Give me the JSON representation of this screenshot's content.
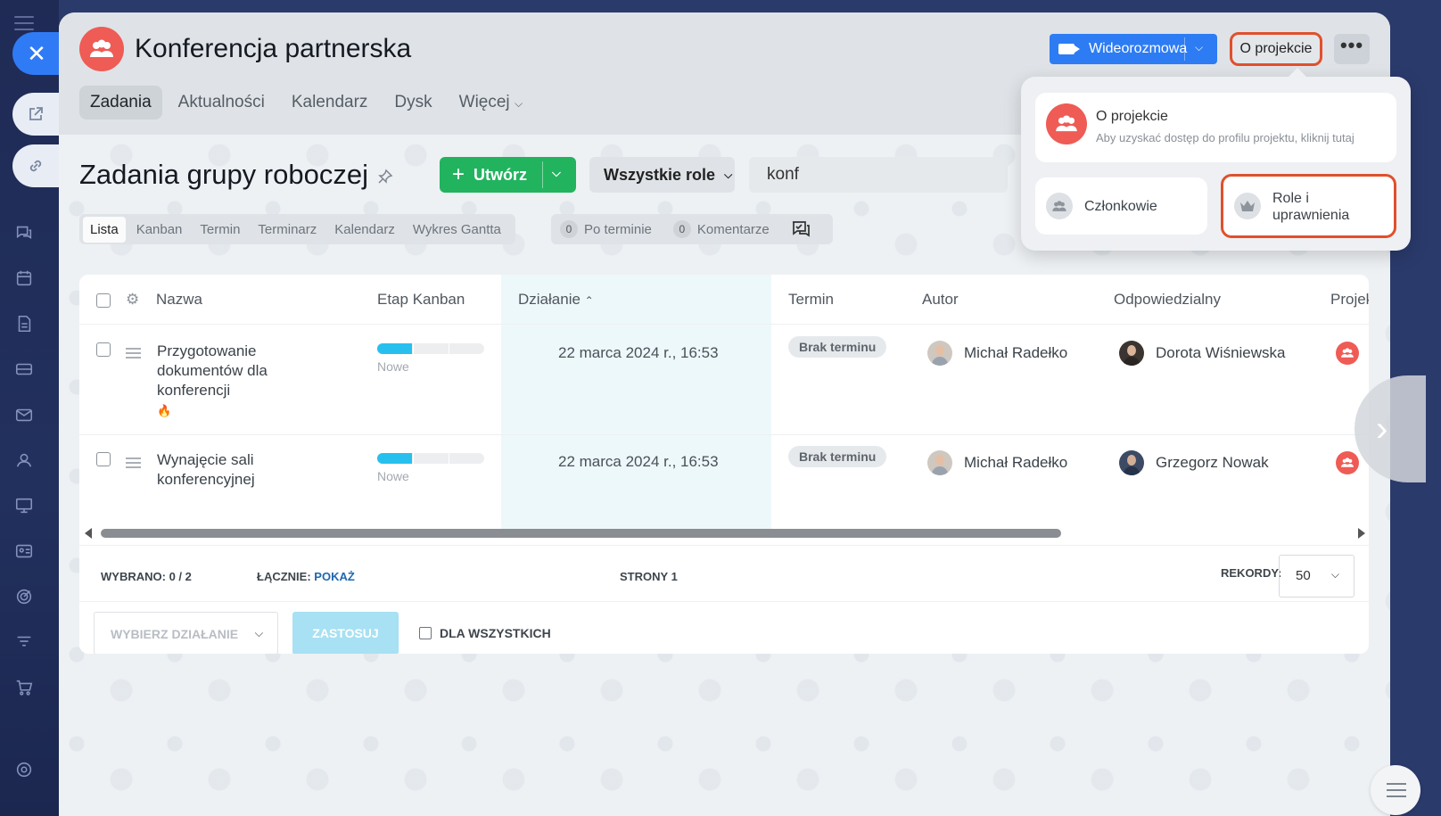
{
  "project": {
    "title": "Konferencja partnerska",
    "video_label": "Wideorozmowa",
    "about_label": "O projekcie",
    "more_label": "•••"
  },
  "tabs": [
    {
      "label": "Zadania",
      "active": true
    },
    {
      "label": "Aktualności"
    },
    {
      "label": "Kalendarz"
    },
    {
      "label": "Dysk"
    },
    {
      "label": "Więcej"
    }
  ],
  "page": {
    "title": "Zadania grupy roboczej",
    "create_label": "Utwórz",
    "roles_label": "Wszystkie role",
    "search_value": "konf"
  },
  "views": [
    "Lista",
    "Kanban",
    "Termin",
    "Terminarz",
    "Kalendarz",
    "Wykres Gantta"
  ],
  "counters": [
    {
      "count": "0",
      "label": "Po terminie"
    },
    {
      "count": "0",
      "label": "Komentarze"
    }
  ],
  "grid": {
    "columns": {
      "name": "Nazwa",
      "kanban": "Etap Kanban",
      "action": "Działanie",
      "deadline": "Termin",
      "author": "Autor",
      "responsible": "Odpowiedzialny",
      "project": "Projekt"
    },
    "rows": [
      {
        "name": "Przygotowanie dokumentów dla konferencji",
        "flame": "🔥",
        "stage": "Nowe",
        "stage_progress": 0.33,
        "action_date": "22 marca 2024 r., 16:53",
        "deadline": "Brak terminu",
        "author": "Michał Radełko",
        "responsible": "Dorota Wiśniewska"
      },
      {
        "name": "Wynajęcie sali konferencyjnej",
        "stage": "Nowe",
        "stage_progress": 0.33,
        "action_date": "22 marca 2024 r., 16:53",
        "deadline": "Brak terminu",
        "author": "Michał Radełko",
        "responsible": "Grzegorz Nowak"
      }
    ]
  },
  "footer": {
    "selected_label": "WYBRANO:",
    "selected_value": "0 / 2",
    "total_label": "ŁĄCZNIE:",
    "total_link": "POKAŻ",
    "pages_label": "STRONY",
    "pages_value": "1",
    "records_label": "REKORDY:",
    "records_value": "50",
    "action_placeholder": "WYBIERZ DZIAŁANIE",
    "apply_label": "ZASTOSUJ",
    "forall_label": "DLA WSZYSTKICH"
  },
  "popup": {
    "about_title": "O projekcie",
    "about_subtitle": "Aby uzyskać dostęp do profilu projektu, kliknij tutaj",
    "members_label": "Członkowie",
    "roles_label_line1": "Role i",
    "roles_label_line2": "uprawnienia"
  },
  "colors": {
    "accent": "#2d7cf4",
    "create": "#22b35f",
    "project_avatar": "#ef5b55",
    "highlight": "#e0502d"
  }
}
